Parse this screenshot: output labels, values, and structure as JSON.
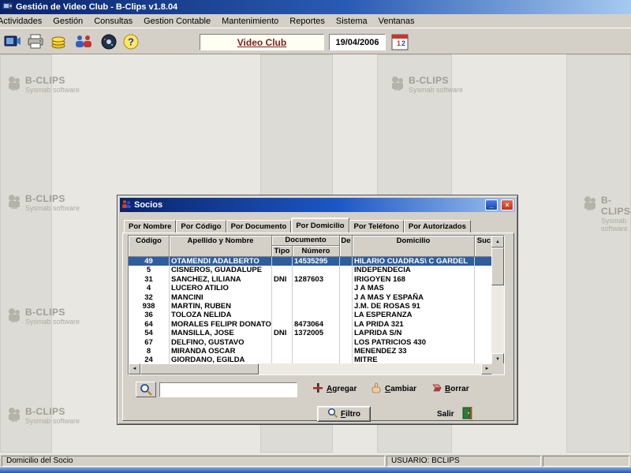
{
  "window": {
    "title": "Gestión de Video Club - B-Clips v1.8.04"
  },
  "menu": {
    "items": [
      "Actividades",
      "Gestión",
      "Consultas",
      "Gestion Contable",
      "Mantenimiento",
      "Reportes",
      "Sistema",
      "Ventanas"
    ]
  },
  "toolbar": {
    "app_label": "Video Club",
    "date": "19/04/2006"
  },
  "watermark": {
    "brand": "B-CLIPS",
    "subtitle": "Sysmab software"
  },
  "dialog": {
    "title": "Socios",
    "tabs": [
      {
        "label": "Por Nombre",
        "active": false
      },
      {
        "label": "Por Código",
        "active": false
      },
      {
        "label": "Por Documento",
        "active": false
      },
      {
        "label": "Por Domicilio",
        "active": true
      },
      {
        "label": "Por Teléfono",
        "active": false
      },
      {
        "label": "Por Autorizados",
        "active": false
      }
    ],
    "table": {
      "headers": {
        "codigo": "Código",
        "apellido": "Apellido y Nombre",
        "documento": "Documento",
        "tipo": "Tipo",
        "numero": "Número",
        "de": "De",
        "domicilio": "Domicilio",
        "suc": "Suc"
      },
      "rows": [
        {
          "codigo": "49",
          "apellido": "OTAMENDI ADALBERTO",
          "tipo": "",
          "numero": "14535295",
          "de": "",
          "domicilio": "HILARIO CUADRAS\\ C GARDEL",
          "suc": "",
          "selected": true
        },
        {
          "codigo": "5",
          "apellido": "CISNEROS, GUADALUPE",
          "tipo": "",
          "numero": "",
          "de": "",
          "domicilio": "INDEPENDECIA",
          "suc": "",
          "selected": false
        },
        {
          "codigo": "31",
          "apellido": "SANCHEZ, LILIANA",
          "tipo": "DNI",
          "numero": "1287603",
          "de": "",
          "domicilio": "IRIGOYEN 168",
          "suc": "",
          "selected": false
        },
        {
          "codigo": "4",
          "apellido": "LUCERO ATILIO",
          "tipo": "",
          "numero": "",
          "de": "",
          "domicilio": "J A MAS",
          "suc": "",
          "selected": false
        },
        {
          "codigo": "32",
          "apellido": "MANCINI",
          "tipo": "",
          "numero": "",
          "de": "",
          "domicilio": "J A MAS Y ESPAÑA",
          "suc": "",
          "selected": false
        },
        {
          "codigo": "938",
          "apellido": "MARTIN, RUBEN",
          "tipo": "",
          "numero": "",
          "de": "",
          "domicilio": "J.M. DE ROSAS 91",
          "suc": "",
          "selected": false
        },
        {
          "codigo": "36",
          "apellido": "TOLOZA NELIDA",
          "tipo": "",
          "numero": "",
          "de": "",
          "domicilio": "LA ESPERANZA",
          "suc": "",
          "selected": false
        },
        {
          "codigo": "64",
          "apellido": "MORALES FELIPR DONATO",
          "tipo": "",
          "numero": "8473064",
          "de": "",
          "domicilio": "LA PRIDA 321",
          "suc": "",
          "selected": false
        },
        {
          "codigo": "54",
          "apellido": "MANSILLA, JOSE",
          "tipo": "DNI",
          "numero": "1372005",
          "de": "",
          "domicilio": "LAPRIDA S/N",
          "suc": "",
          "selected": false
        },
        {
          "codigo": "67",
          "apellido": "DELFINO, GUSTAVO",
          "tipo": "",
          "numero": "",
          "de": "",
          "domicilio": "LOS PATRICIOS 430",
          "suc": "",
          "selected": false
        },
        {
          "codigo": "8",
          "apellido": "MIRANDA OSCAR",
          "tipo": "",
          "numero": "",
          "de": "",
          "domicilio": "MENENDEZ 33",
          "suc": "",
          "selected": false
        },
        {
          "codigo": "24",
          "apellido": "GIORDANO, EGILDA",
          "tipo": "",
          "numero": "",
          "de": "",
          "domicilio": "MITRE",
          "suc": "",
          "selected": false
        }
      ]
    },
    "search_value": "",
    "buttons": {
      "agregar": "Agregar",
      "cambiar": "Cambiar",
      "borrar": "Borrar",
      "filtro": "Filtro",
      "salir": "Salir"
    }
  },
  "statusbar": {
    "left": "Domicilio del Socio",
    "user": "USUARIO: BCLIPS"
  }
}
